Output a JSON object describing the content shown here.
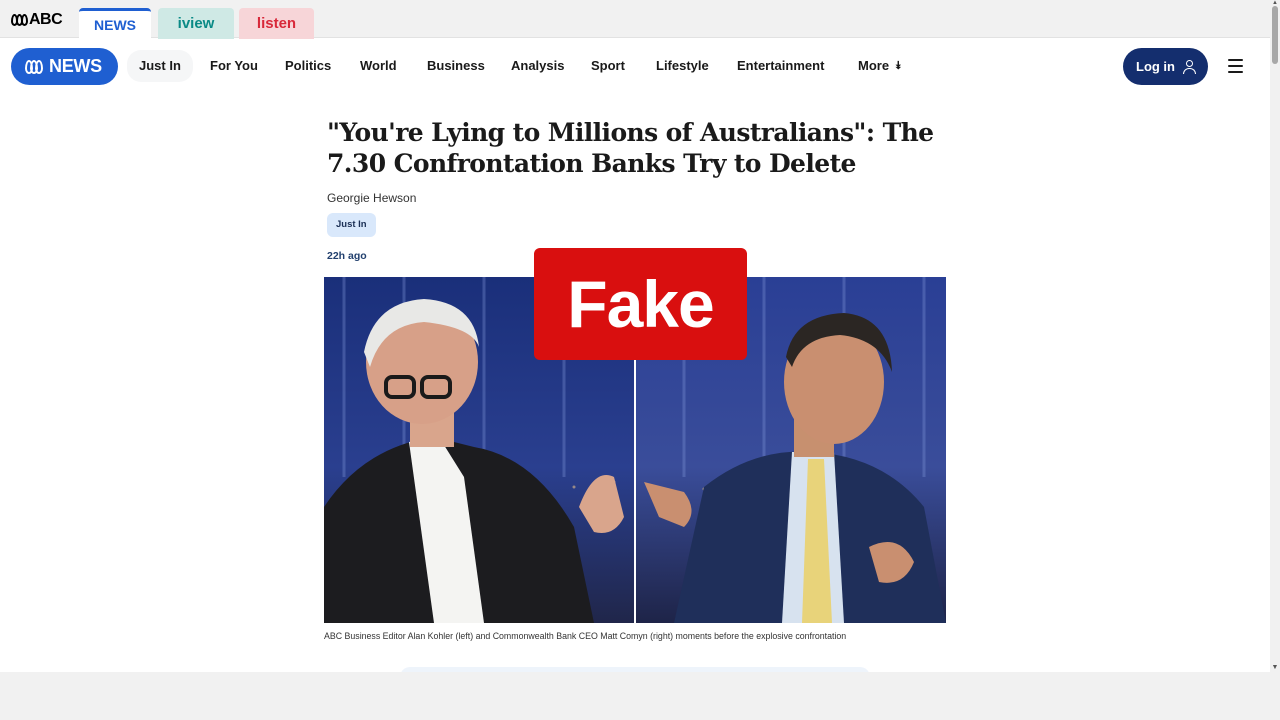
{
  "platform_tabs": {
    "news": "NEWS",
    "iview": "iview",
    "listen": "listen"
  },
  "abc_logo": {
    "text": "ABC"
  },
  "news_logo": {
    "text": "NEWS"
  },
  "nav": {
    "items": [
      "Just In",
      "For You",
      "Politics",
      "World",
      "Business",
      "Analysis",
      "Sport",
      "Lifestyle",
      "Entertainment",
      "More"
    ],
    "login": "Log in"
  },
  "article": {
    "headline": "\"You're Lying to Millions of Australians\": The 7.30 Confrontation Banks Try to Delete",
    "author": "Georgie Hewson",
    "tag": "Just In",
    "timestamp": "22h ago",
    "caption": "ABC Business Editor Alan Kohler (left) and Commonwealth Bank CEO Matt Comyn (right) moments before the explosive confrontation",
    "overlay_label": "Fake"
  },
  "colors": {
    "abc_blue": "#1f5fd1",
    "login_navy": "#142e6e",
    "fake_red": "#d90f0f"
  }
}
